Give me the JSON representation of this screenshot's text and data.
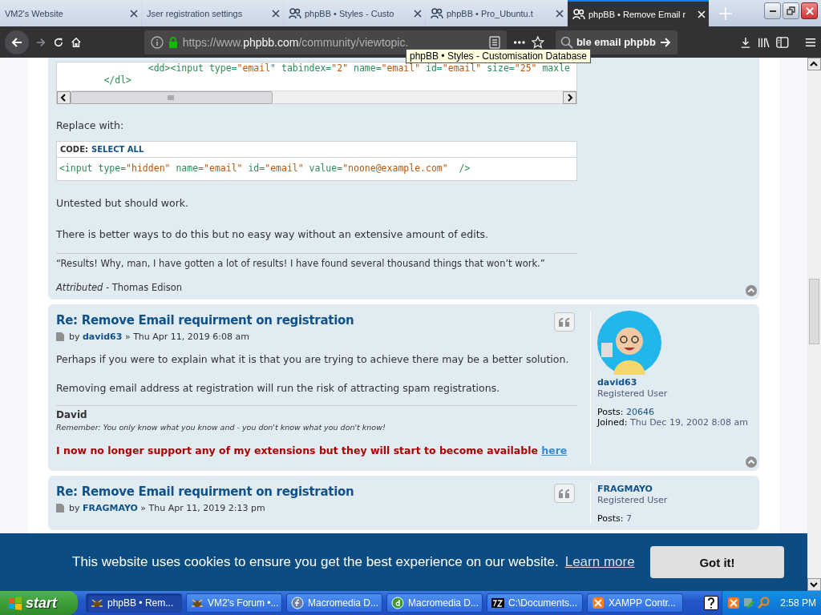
{
  "browser": {
    "tabs": [
      {
        "title": "VM2's Website",
        "has_icon": false,
        "selected": false
      },
      {
        "title": "Jser registration settings",
        "has_icon": false,
        "selected": false
      },
      {
        "title": "phpBB • Styles - Custo",
        "has_icon": true,
        "selected": false
      },
      {
        "title": "phpBB • Pro_Ubuntu.t",
        "has_icon": true,
        "selected": false
      },
      {
        "title": "phpBB • Remove Email r",
        "has_icon": true,
        "selected": true
      }
    ],
    "tooltip": "phpBB • Styles - Customisation Database",
    "url": "https://www.phpbb.com/community/viewtopic.",
    "search": {
      "value": "ble email phpbb"
    }
  },
  "page": {
    "code_block": {
      "lines": [
        "                <dd><input type=\"email\" tabindex=\"2\" name=\"email\" id=\"email\" size=\"25\" maxle",
        "        </dl>"
      ]
    },
    "replace_label": "Replace with:",
    "code_box": {
      "label": "CODE:",
      "action": "SELECT ALL",
      "lines": [
        "<input type=\"hidden\" name=\"email\" id=\"email\" value=\"noone@example.com\"  />"
      ]
    },
    "paragraphs": [
      "Untested but should work.",
      "There is better ways to do this but no easy way without an extensive amount of edits."
    ],
    "signature": {
      "quote": "“Results! Why, man, I have gotten a lot of results! I have found several thousand things that won’t work.”",
      "attribution": "*Attributed* - Thomas Edison"
    },
    "posts": [
      {
        "title": "Re: Remove Email requirment on registration",
        "byline": {
          "prefix": "by",
          "author": "david63",
          "suffix": "» Thu Apr 11, 2019 6:08 am"
        },
        "body": [
          "Perhaps if you were to explain what it is that you are trying to achieve there may be a better solution.",
          "Removing email address at registration will run the risk of attracting spam registrations."
        ],
        "signature": {
          "name": "David",
          "motto": "Remember: You only know what you know and - you don't know what you don't know!",
          "notice": "I now no longer support any of my extensions but they will start to become available",
          "link": "here"
        },
        "profile": {
          "name": "david63",
          "rank": "Registered User",
          "avatar": true,
          "fields": [
            {
              "label": "Posts:",
              "value": "20646",
              "link": true
            },
            {
              "label": "Joined:",
              "value": "Thu Dec 19, 2002 8:08 am"
            }
          ]
        }
      },
      {
        "title": "Re: Remove Email requirment on registration",
        "byline": {
          "prefix": "by",
          "author": "FRAGMAYO",
          "suffix": "» Thu Apr 11, 2019 2:13 pm"
        },
        "profile": {
          "name": "FRAGMAYO",
          "rank": "Registered User",
          "fields": [
            {
              "label": "Posts:",
              "value": "7"
            }
          ]
        }
      }
    ]
  },
  "cookie_banner": {
    "message": "This website uses cookies to ensure you get the best experience on our website.",
    "link": "Learn more",
    "button": "Got it!"
  },
  "taskbar": {
    "start": "start",
    "items": [
      {
        "label": "phpBB • Rem...",
        "selected": true
      },
      {
        "label": "VM2's Forum •...",
        "selected": false
      },
      {
        "label": "Macromedia D...",
        "selected": false
      },
      {
        "label": "Macromedia D...",
        "selected": false
      },
      {
        "label": "C:\\Documents...",
        "selected": false
      },
      {
        "label": "XAMPP Contr...",
        "selected": false
      }
    ],
    "clock": "2:58 PM"
  }
}
